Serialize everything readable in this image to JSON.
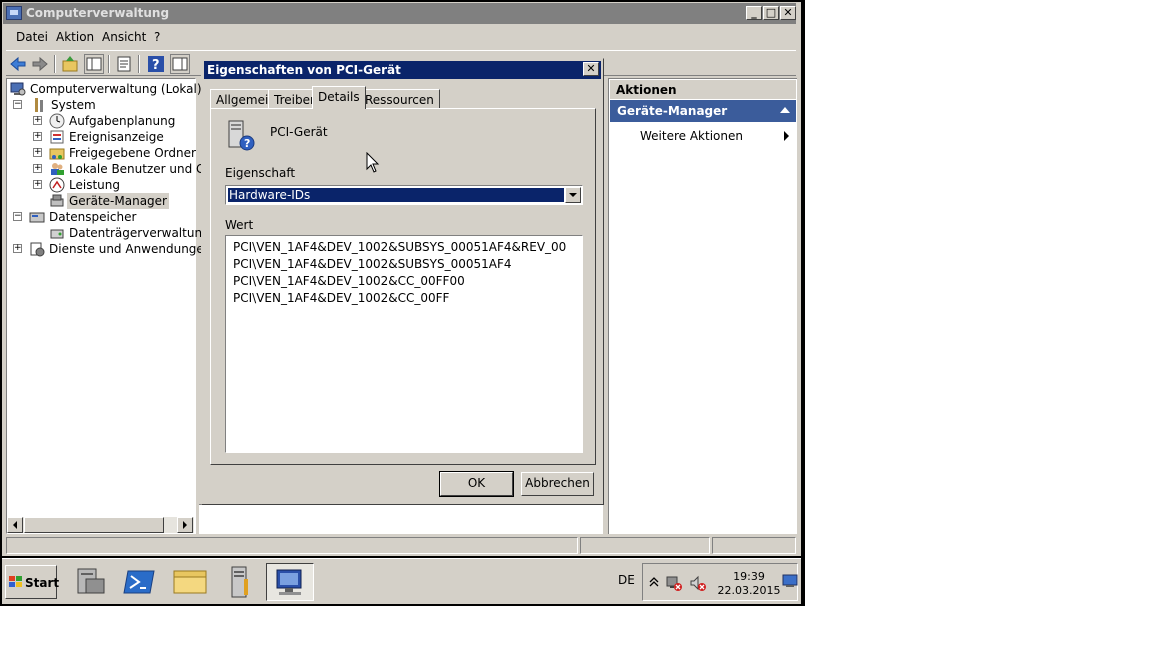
{
  "window": {
    "title": "Computerverwaltung",
    "controls": {
      "minimize": "_",
      "maximize": "□",
      "close": "✕"
    }
  },
  "menu": {
    "items": [
      "Datei",
      "Aktion",
      "Ansicht",
      "?"
    ]
  },
  "toolbar": {
    "icons": [
      "back-icon",
      "forward-icon",
      "up-folder-icon",
      "show-hide-tree-icon",
      "properties-icon",
      "help-icon",
      "show-hide-action-pane-icon"
    ]
  },
  "tree": {
    "items": [
      {
        "label": "Computerverwaltung (Lokal)",
        "icon": "computer-management-icon"
      },
      {
        "label": "System",
        "icon": "tools-icon",
        "expander": "−"
      },
      {
        "label": "Aufgabenplanung",
        "icon": "clock-icon",
        "expander": "+"
      },
      {
        "label": "Ereignisanzeige",
        "icon": "event-viewer-icon",
        "expander": "+"
      },
      {
        "label": "Freigegebene Ordner",
        "icon": "shared-folder-icon",
        "expander": "+"
      },
      {
        "label": "Lokale Benutzer und Grupp",
        "icon": "users-icon",
        "expander": "+"
      },
      {
        "label": "Leistung",
        "icon": "performance-icon",
        "expander": "+"
      },
      {
        "label": "Geräte-Manager",
        "icon": "device-manager-icon",
        "selected": true
      },
      {
        "label": "Datenspeicher",
        "icon": "storage-icon",
        "expander": "−"
      },
      {
        "label": "Datenträgerverwaltung",
        "icon": "disk-icon"
      },
      {
        "label": "Dienste und Anwendungen",
        "icon": "services-icon",
        "expander": "+"
      }
    ]
  },
  "actions": {
    "header": "Aktionen",
    "section": "Geräte-Manager",
    "item": "Weitere Aktionen"
  },
  "dialog": {
    "title": "Eigenschaften von PCI-Gerät",
    "close": "✕",
    "tabs": [
      "Allgemein",
      "Treiber",
      "Details",
      "Ressourcen"
    ],
    "active_tab": "Details",
    "device_name": "PCI-Gerät",
    "property_label": "Eigenschaft",
    "property_value": "Hardware-IDs",
    "value_label": "Wert",
    "values": [
      "PCI\\VEN_1AF4&DEV_1002&SUBSYS_00051AF4&REV_00",
      "PCI\\VEN_1AF4&DEV_1002&SUBSYS_00051AF4",
      "PCI\\VEN_1AF4&DEV_1002&CC_00FF00",
      "PCI\\VEN_1AF4&DEV_1002&CC_00FF"
    ],
    "ok_label": "OK",
    "cancel_label": "Abbrechen"
  },
  "taskbar": {
    "start_label": "Start",
    "apps": [
      "server-manager-icon",
      "powershell-icon",
      "explorer-icon",
      "device-settings-icon",
      "computer-management-icon"
    ],
    "language": "DE",
    "time": "19:39",
    "date": "22.03.2015"
  },
  "colors": {
    "dialog_title_bg": "#0a246a",
    "actions_section_bg": "#3b5c9b",
    "face": "#d4d0c8"
  }
}
